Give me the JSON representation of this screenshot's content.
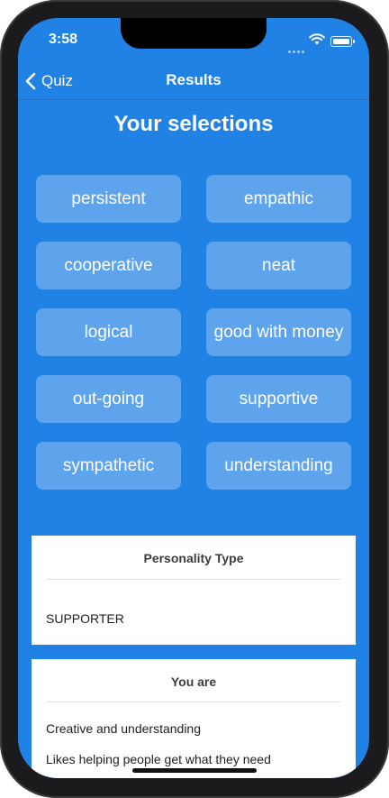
{
  "status_bar": {
    "time": "3:58"
  },
  "nav": {
    "back_label": "Quiz",
    "title": "Results"
  },
  "heading": "Your selections",
  "selections": [
    "persistent",
    "empathic",
    "cooperative",
    "neat",
    "logical",
    "good with money",
    "out-going",
    "supportive",
    "sympathetic",
    "understanding"
  ],
  "personality_card": {
    "header": "Personality Type",
    "value": "SUPPORTER"
  },
  "you_are_card": {
    "header": "You are",
    "items": [
      "Creative and understanding",
      "Likes helping people get what they need"
    ]
  },
  "colors": {
    "background": "#2182e6",
    "chip": "#5ea5ef",
    "card": "#ffffff"
  }
}
